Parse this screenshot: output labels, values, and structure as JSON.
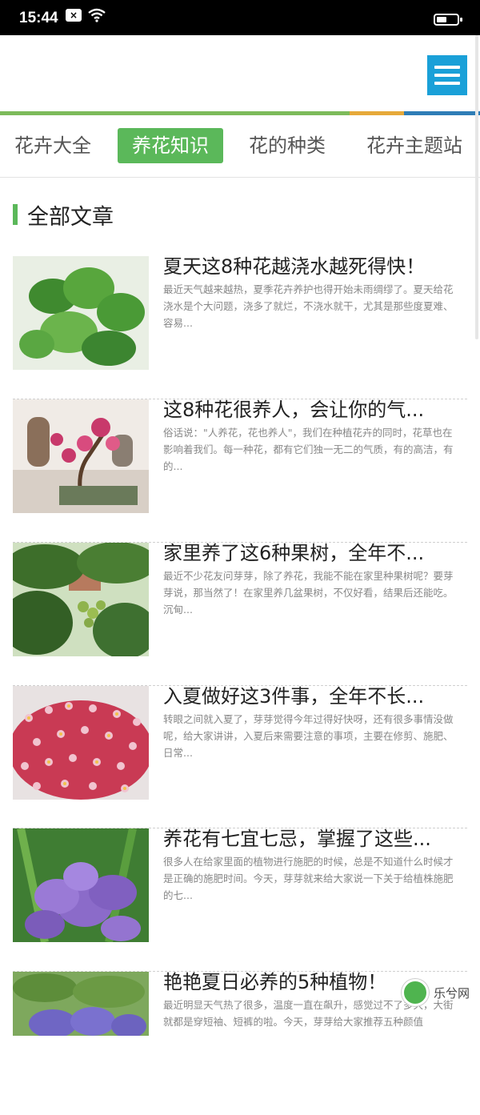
{
  "status_bar": {
    "time": "15:44",
    "notification": "×"
  },
  "tabs": [
    {
      "label": "花卉大全"
    },
    {
      "label": "养花知识"
    },
    {
      "label": "花的种类"
    },
    {
      "label": "花卉主题站"
    }
  ],
  "section": {
    "title": "全部文章"
  },
  "articles": [
    {
      "title": "夏天这8种花越浇水越死得快！",
      "summary": "最近天气越来越热，夏季花卉养护也得开始未雨绸缪了。夏天给花浇水是个大问题，浇多了就烂，不浇水就干，尤其是那些度夏难、容易..."
    },
    {
      "title": "这8种花很养人，会让你的气...",
      "summary": "俗话说：\"人养花，花也养人\"，我们在种植花卉的同时，花草也在影响着我们。每一种花，都有它们独一无二的气质，有的高洁，有的..."
    },
    {
      "title": "家里养了这6种果树，全年不...",
      "summary": "最近不少花友问芽芽，除了养花，我能不能在家里种果树呢？要芽芽说，那当然了！在家里养几盆果树，不仅好看，结果后还能吃。沉甸..."
    },
    {
      "title": "入夏做好这3件事，全年不长...",
      "summary": "转眼之间就入夏了，芽芽觉得今年过得好快呀，还有很多事情没做呢，给大家讲讲，入夏后来需要注意的事项，主要在修剪、施肥、日常..."
    },
    {
      "title": "养花有七宜七忌，掌握了这些...",
      "summary": "很多人在给家里面的植物进行施肥的时候，总是不知道什么时候才是正确的施肥时间。今天，芽芽就来给大家说一下关于给植株施肥的七..."
    },
    {
      "title": "艳艳夏日必养的5种植物！",
      "summary": "最近明显天气热了很多，温度一直在飙升，感觉过不了多久，大街就都是穿短袖、短裤的啦。今天，芽芽给大家推荐五种颜值"
    }
  ],
  "watermark": {
    "text": "乐兮网"
  },
  "colors": {
    "accent": "#5bb85a",
    "menu": "#1aa0d8"
  }
}
